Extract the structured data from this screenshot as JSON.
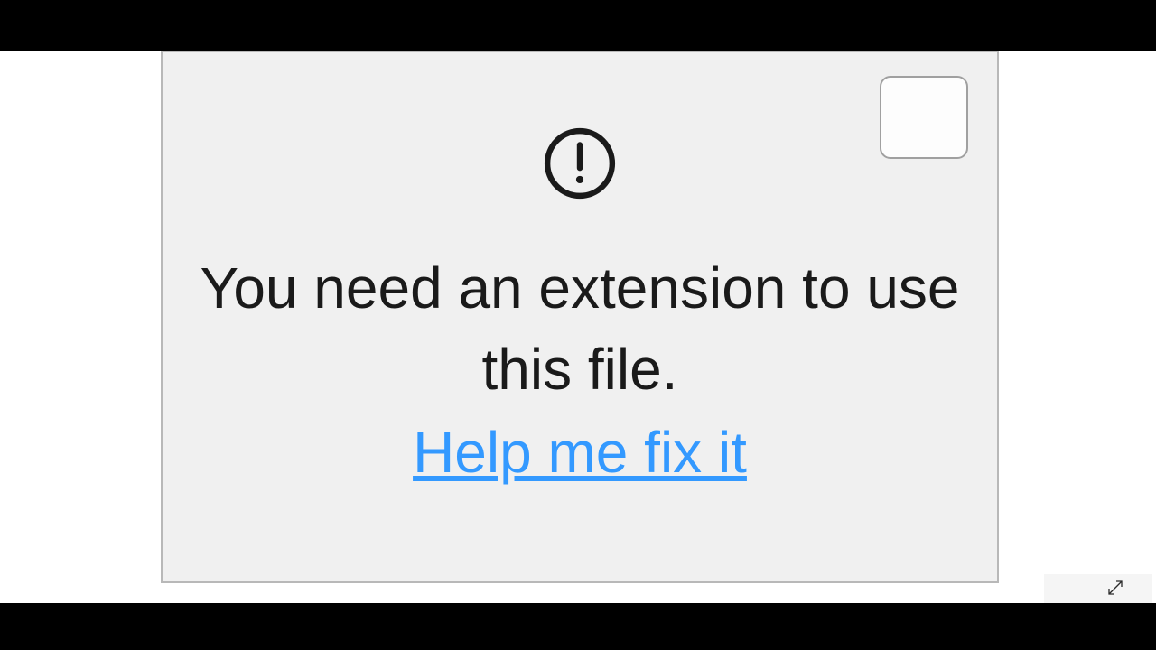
{
  "dialog": {
    "message": "You need an extension to use this file.",
    "help_link_label": "Help me fix it"
  }
}
